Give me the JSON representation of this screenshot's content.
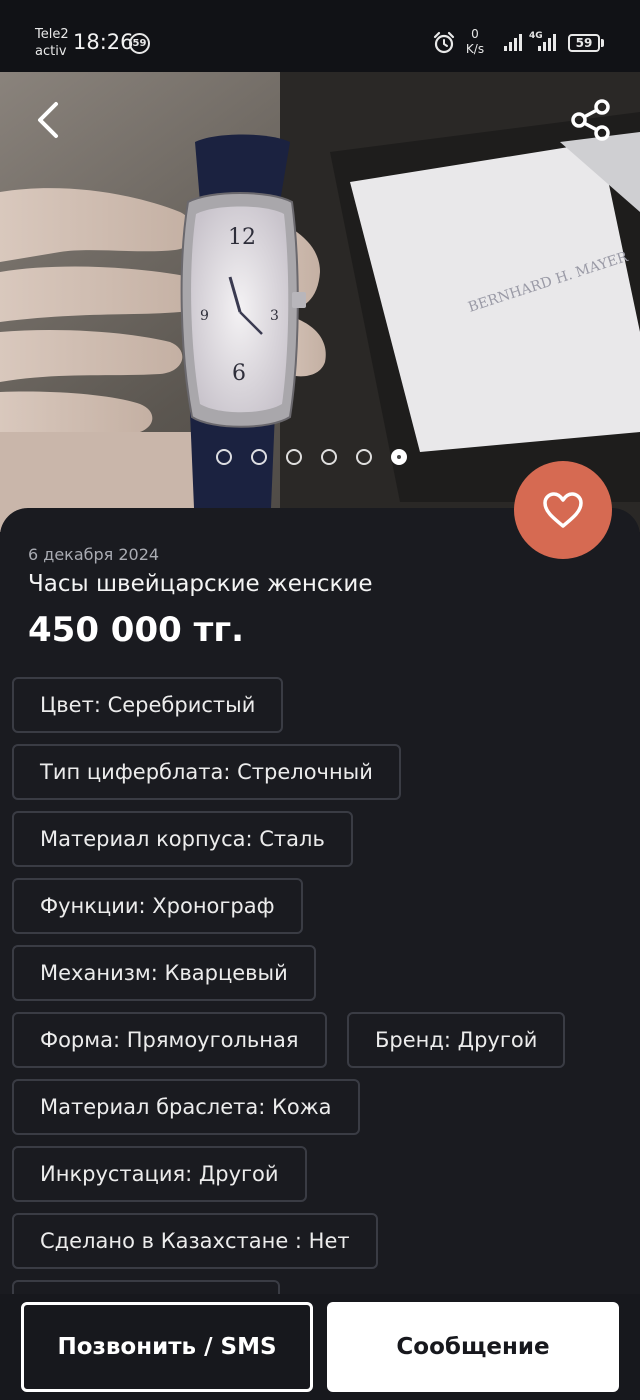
{
  "status_bar": {
    "carrier_line1": "Tele2",
    "carrier_line2": "activ",
    "time": "18:26",
    "notification_count": "59",
    "net_speed_value": "0",
    "net_speed_unit": "K/s",
    "network_type": "4G",
    "battery": "59",
    "icons": [
      "alarm-icon",
      "signal-icon",
      "signal-icon",
      "battery-icon"
    ]
  },
  "photo": {
    "slide_count": 6,
    "active_slide": 6
  },
  "toolbar": {
    "back_icon": "chevron-left-icon",
    "share_icon": "share-icon",
    "favorite_icon": "heart-icon",
    "favorite_color": "#d66a52"
  },
  "listing": {
    "date": "6 декабря 2024",
    "title": "Часы швейцарские женские",
    "price": "450 000 тг."
  },
  "attributes": [
    "Цвет: Серебристый",
    "Тип циферблата: Стрелочный",
    "Материал корпуса: Сталь",
    "Функции: Хронограф",
    "Механизм: Кварцевый",
    "Форма: Прямоугольная",
    "Бренд: Другой",
    "Материал браслета: Кожа",
    "Инкрустация: Другой",
    "Сделано в Казахстане : Нет"
  ],
  "actions": {
    "call_label": "Позвонить / SMS",
    "message_label": "Сообщение"
  }
}
